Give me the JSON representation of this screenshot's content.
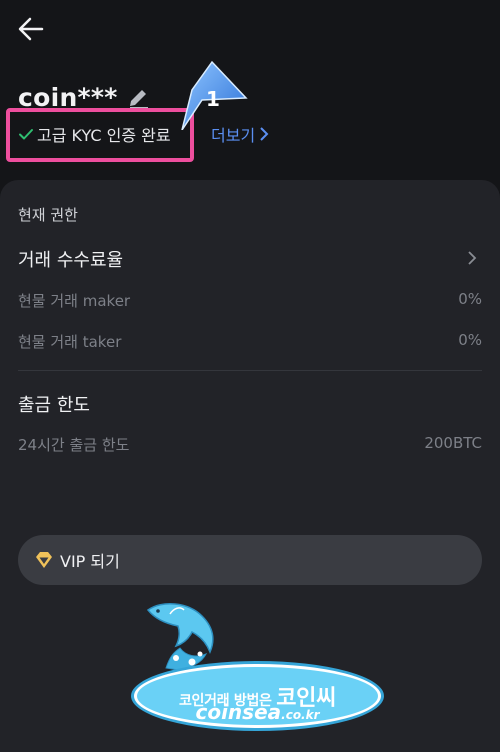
{
  "header": {
    "username": "coin***",
    "kyc_status": "고급 KYC 인증 완료",
    "more_link": "더보기",
    "callout_number": "1"
  },
  "permissions": {
    "section_title": "현재 권한",
    "fee_title": "거래 수수료율",
    "rows": [
      {
        "label": "현물 거래 maker",
        "value": "0%"
      },
      {
        "label": "현물 거래 taker",
        "value": "0%"
      }
    ]
  },
  "withdrawal": {
    "title": "출금 한도",
    "label": "24시간 출금 한도",
    "value": "200BTC"
  },
  "vip": {
    "label": "VIP 되기"
  },
  "watermark": {
    "line1_small": "코인거래 방법은 ",
    "line1_big": "코인씨",
    "line2_main": "coinsea",
    "line2_small": ".co.kr"
  },
  "colors": {
    "background": "#141518",
    "card": "#222328",
    "accent_link": "#5b8ff2",
    "check_green": "#2fbf71",
    "highlight_pink": "#ee4f9e",
    "callout_blue": "#3a87e8"
  },
  "icons": [
    "back-arrow-icon",
    "pencil-icon",
    "check-icon",
    "chevron-right-icon",
    "diamond-icon",
    "dolphin-icon"
  ]
}
